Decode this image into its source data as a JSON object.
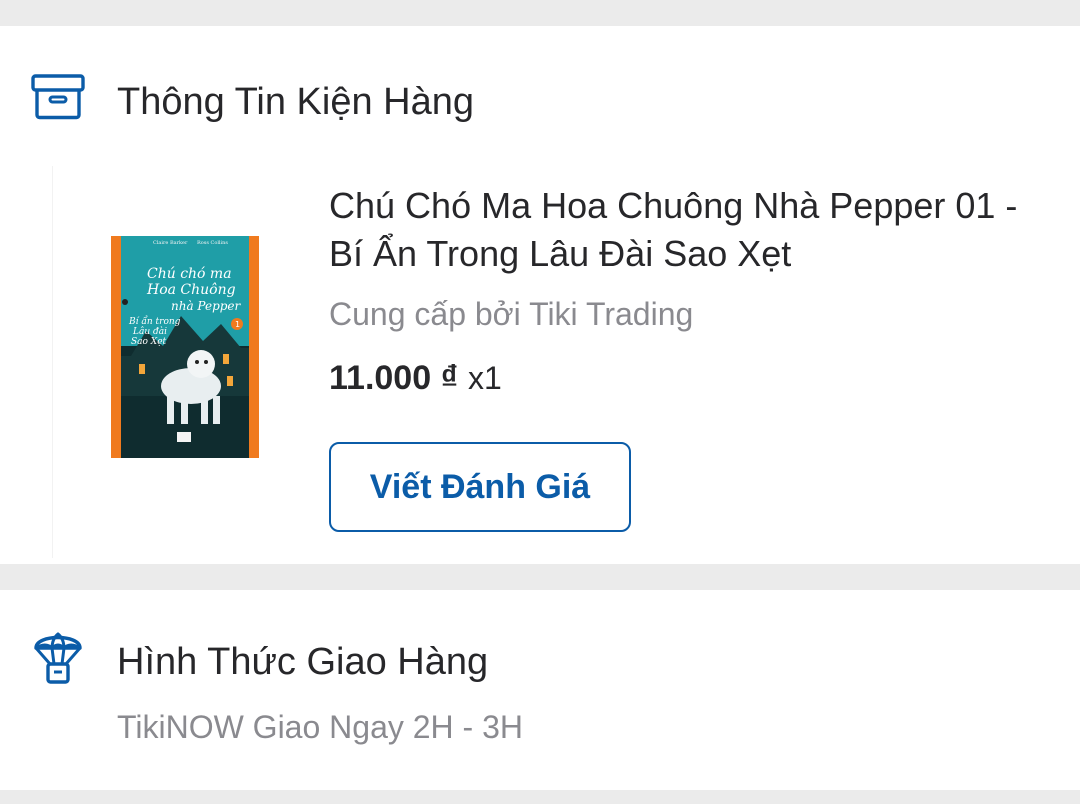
{
  "package_section": {
    "title": "Thông Tin Kiện Hàng",
    "icon": "package-box-icon",
    "product": {
      "name": "Chú Chó Ma Hoa Chuông Nhà Pepper 01 - Bí Ẩn Trong Lâu Đài Sao Xẹt",
      "seller": "Cung cấp bởi Tiki Trading",
      "price": "11.000 ₫",
      "quantity": "x1",
      "review_button_label": "Viết Đánh Giá",
      "cover": {
        "author": "Claire Barker",
        "illustrator": "Ross Collins",
        "title_lines": [
          "Chú chó ma",
          "Hoa Chuông",
          "nhà Pepper"
        ],
        "subtitle_lines": [
          "Bí ẩn trong",
          "Lâu đài",
          "Sao Xẹt"
        ],
        "volume": "1"
      }
    }
  },
  "shipping_section": {
    "title": "Hình Thức Giao Hàng",
    "icon": "parachute-delivery-icon",
    "method": "TikiNOW Giao Ngay 2H - 3H"
  },
  "colors": {
    "accent": "#0b5ca8",
    "text_primary": "#27272a",
    "text_secondary": "#8a8a8f",
    "background": "#ebebeb",
    "card": "#ffffff"
  }
}
